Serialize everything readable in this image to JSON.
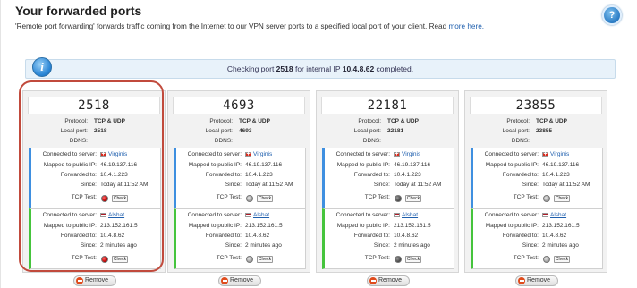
{
  "header": {
    "title": "Your forwarded ports",
    "help_icon": "help-icon",
    "desc_prefix": "'Remote port forwarding' forwards traffic coming from the Internet to our VPN server ports to a specified local port of your client. Read ",
    "desc_link": "more here."
  },
  "status": {
    "icon": "info-icon",
    "prefix": "Checking port ",
    "port": "2518",
    "middle": " for internal IP ",
    "ip": "10.4.8.62",
    "suffix": " completed."
  },
  "labels": {
    "protocol": "Protocol:",
    "local_port": "Local port:",
    "ddns": "DDNS:",
    "connected": "Connected to server:",
    "mapped": "Mapped to public IP:",
    "forwarded": "Forwarded to:",
    "since": "Since:",
    "tcp_test": "TCP Test:",
    "check": "Check",
    "remove": "Remove"
  },
  "ports": [
    {
      "port": "2518",
      "protocol": "TCP & UDP",
      "local_port": "2518",
      "ddns": "",
      "servers": [
        {
          "name": "Virginis",
          "flag": "switzerland",
          "public_ip": "46.19.137.116",
          "forwarded": "10.4.1.223",
          "since": "Today at 11:52 AM",
          "tcp_status": "red"
        },
        {
          "name": "Alshat",
          "flag": "netherlands",
          "public_ip": "213.152.161.5",
          "forwarded": "10.4.8.62",
          "since": "2 minutes ago",
          "tcp_status": "red"
        }
      ]
    },
    {
      "port": "4693",
      "protocol": "TCP & UDP",
      "local_port": "4693",
      "ddns": "",
      "servers": [
        {
          "name": "Virginis",
          "flag": "switzerland",
          "public_ip": "46.19.137.116",
          "forwarded": "10.4.1.223",
          "since": "Today at 11:52 AM",
          "tcp_status": "gray"
        },
        {
          "name": "Alshat",
          "flag": "netherlands",
          "public_ip": "213.152.161.5",
          "forwarded": "10.4.8.62",
          "since": "2 minutes ago",
          "tcp_status": "gray"
        }
      ]
    },
    {
      "port": "22181",
      "protocol": "TCP & UDP",
      "local_port": "22181",
      "ddns": "",
      "servers": [
        {
          "name": "Virginis",
          "flag": "switzerland",
          "public_ip": "46.19.137.116",
          "forwarded": "10.4.1.223",
          "since": "Today at 11:52 AM",
          "tcp_status": "dark"
        },
        {
          "name": "Alshat",
          "flag": "netherlands",
          "public_ip": "213.152.161.5",
          "forwarded": "10.4.8.62",
          "since": "2 minutes ago",
          "tcp_status": "dark"
        }
      ]
    },
    {
      "port": "23855",
      "protocol": "TCP & UDP",
      "local_port": "23855",
      "ddns": "",
      "servers": [
        {
          "name": "Virginis",
          "flag": "switzerland",
          "public_ip": "46.19.137.116",
          "forwarded": "10.4.1.223",
          "since": "Today at 11:52 AM",
          "tcp_status": "gray"
        },
        {
          "name": "Alshat",
          "flag": "netherlands",
          "public_ip": "213.152.161.5",
          "forwarded": "10.4.8.62",
          "since": "2 minutes ago",
          "tcp_status": "gray"
        }
      ]
    }
  ],
  "colors": {
    "accent_blue": "#3e8fe0",
    "accent_green": "#45c43c",
    "highlight_red": "#c14a3c"
  }
}
